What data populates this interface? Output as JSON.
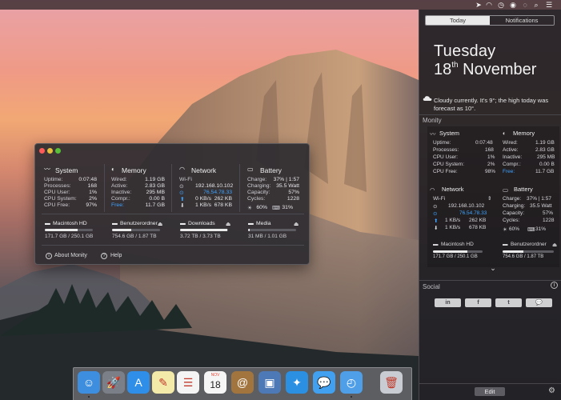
{
  "menubar": {
    "icons": [
      "location-icon",
      "wifi-icon",
      "clock-icon",
      "user-icon",
      "globe-icon",
      "search-icon",
      "notification-center-icon"
    ]
  },
  "notification_center": {
    "tabs": [
      {
        "label": "Today",
        "active": true
      },
      {
        "label": "Notifications",
        "active": false
      }
    ],
    "day": "Tuesday",
    "date_num": "18",
    "date_suffix": "th",
    "date_month": " November",
    "weather": "Cloudy currently. It's 9°; the high today was forecast as 10°.",
    "monity_label": "Monity",
    "social_label": "Social",
    "social_buttons": [
      "in",
      "f",
      "t",
      "💬"
    ],
    "edit_label": "Edit",
    "widget": {
      "system": {
        "title": "System",
        "rows": [
          {
            "label": "Uptime:",
            "value": "0:07:48"
          },
          {
            "label": "Processes:",
            "value": "168"
          },
          {
            "label": "CPU User:",
            "value": "1%"
          },
          {
            "label": "CPU System:",
            "value": "2%"
          },
          {
            "label": "CPU Free:",
            "value": "98%"
          }
        ]
      },
      "memory": {
        "title": "Memory",
        "rows": [
          {
            "label": "Wired:",
            "value": "1.19 GB"
          },
          {
            "label": "Active:",
            "value": "2.83 GB"
          },
          {
            "label": "Inactive:",
            "value": "295 MB"
          },
          {
            "label": "Compr.:",
            "value": "0.00 B"
          },
          {
            "label": "Free:",
            "value": "11.7 GB"
          }
        ]
      },
      "network": {
        "title": "Network",
        "interface": "Wi-Fi",
        "ip_local": "192.168.10.102",
        "ip_public": "76.54.78.33",
        "up": "1 KB/s",
        "up_total": "262 KB",
        "down": "1 KB/s",
        "down_total": "678 KB"
      },
      "battery": {
        "title": "Battery",
        "rows": [
          {
            "label": "Charge:",
            "value": "37% | 1:57"
          },
          {
            "label": "Charging:",
            "value": "35.5 Watt"
          },
          {
            "label": "Capacity:",
            "value": "57%"
          },
          {
            "label": "Cycles:",
            "value": "1228"
          }
        ],
        "brightness": "60%",
        "keyboard": "31%"
      },
      "disks": [
        {
          "name": "Macintosh HD",
          "size": "171.7 GB / 250.1 GB",
          "fill": 0.69
        },
        {
          "name": "Benutzerordner",
          "size": "754.6 GB / 1.87 TB",
          "fill": 0.4
        }
      ]
    }
  },
  "monity_window": {
    "system": {
      "title": "System",
      "rows": [
        {
          "label": "Uptime:",
          "value": "0:07:48"
        },
        {
          "label": "Processes:",
          "value": "168"
        },
        {
          "label": "CPU User:",
          "value": "1%"
        },
        {
          "label": "CPU System:",
          "value": "2%"
        },
        {
          "label": "CPU Free:",
          "value": "97%"
        }
      ]
    },
    "memory": {
      "title": "Memory",
      "rows": [
        {
          "label": "Wired:",
          "value": "1.19 GB"
        },
        {
          "label": "Active:",
          "value": "2.83 GB"
        },
        {
          "label": "Inactive:",
          "value": "295 MB"
        },
        {
          "label": "Compr.:",
          "value": "0.00 B"
        },
        {
          "label": "Free:",
          "value": "11.7 GB"
        }
      ]
    },
    "network": {
      "title": "Network",
      "interface": "Wi-Fi",
      "ip_local": "192.168.10.102",
      "ip_public": "76.54.78.33",
      "up": "0 KB/s",
      "up_total": "262 KB",
      "down": "1 KB/s",
      "down_total": "678 KB"
    },
    "battery": {
      "title": "Battery",
      "rows": [
        {
          "label": "Charge:",
          "value": "37% | 1:57"
        },
        {
          "label": "Charging:",
          "value": "35.5 Watt"
        },
        {
          "label": "Capacity:",
          "value": "57%"
        },
        {
          "label": "Cycles:",
          "value": "1228"
        }
      ],
      "brightness": "60%",
      "keyboard": "31%"
    },
    "disks": [
      {
        "name": "Macintosh HD",
        "size": "171.7 GB / 250.1 GB",
        "fill": 0.69
      },
      {
        "name": "Benutzerordner",
        "size": "754.6 GB / 1.87 TB",
        "fill": 0.4
      },
      {
        "name": "Downloads",
        "size": "3.72 TB / 3.73 TB",
        "fill": 0.99
      },
      {
        "name": "Media",
        "size": "31 MB / 1.01 GB",
        "fill": 0.03
      }
    ],
    "about_label": "About Monity",
    "help_label": "Help"
  },
  "dock": {
    "apps": [
      {
        "name": "finder-icon",
        "glyph": "☺",
        "color": "#3e8ee0",
        "running": true
      },
      {
        "name": "launchpad-icon",
        "glyph": "🚀",
        "color": "#7b7f88",
        "running": false
      },
      {
        "name": "app-store-icon",
        "glyph": "A",
        "color": "#2f8fe8",
        "running": false
      },
      {
        "name": "notes-icon",
        "glyph": "✎",
        "color": "#f3e9a8",
        "running": false
      },
      {
        "name": "reminders-icon",
        "glyph": "☰",
        "color": "#f4f4f4",
        "running": false
      },
      {
        "name": "calendar-icon",
        "glyph": "18",
        "color": "#f6f6f6",
        "running": false
      },
      {
        "name": "contacts-icon",
        "glyph": "@",
        "color": "#a2743e",
        "running": false
      },
      {
        "name": "preview-icon",
        "glyph": "▣",
        "color": "#4d79b6",
        "running": false
      },
      {
        "name": "safari-icon",
        "glyph": "✦",
        "color": "#2b8fe2",
        "running": false
      },
      {
        "name": "messages-icon",
        "glyph": "💬",
        "color": "#42a0f0",
        "running": false
      },
      {
        "name": "monity-icon",
        "glyph": "◴",
        "color": "#4e9ee8",
        "running": true
      },
      {
        "name": "trash-icon",
        "glyph": "🗑",
        "color": "#c9cdd3",
        "running": false
      }
    ],
    "calendar_month": "NOV"
  },
  "colors": {
    "accent_blue": "#3ea3ff",
    "panel": "#2e2c30"
  }
}
